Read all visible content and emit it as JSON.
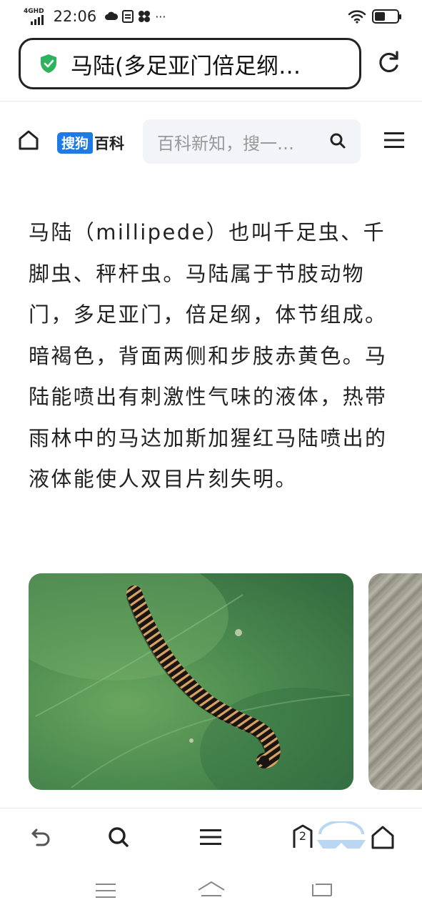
{
  "status_bar": {
    "network": "4GHD",
    "time": "22:06",
    "notification_icons": [
      "cloud-icon",
      "sim-icon",
      "fan-icon",
      "more-dots"
    ],
    "more": "···",
    "battery_level": 0.45
  },
  "browser": {
    "url_title": "马陆(多足亚门倍足纲…",
    "secure": true
  },
  "site": {
    "logo_brand": "搜狗",
    "logo_product": "百科",
    "search_placeholder": "百科新知，搜一…"
  },
  "article": {
    "text": "马陆（millipede）也叫千足虫、千脚虫、秤杆虫。马陆属于节肢动物门，多足亚门，倍足纲，体节组成。暗褐色，背面两侧和步肢赤黄色。马陆能喷出有刺激性气味的液体，热带雨林中的马达加斯加猩红马陆喷出的液体能使人双目片刻失明。"
  },
  "gallery": {
    "images": [
      "millipede-on-leaf",
      "rock-texture"
    ]
  },
  "bottom_nav": {
    "tab_count": "2"
  },
  "colors": {
    "accent_blue": "#1e7be6",
    "secure_green": "#2db35d"
  }
}
